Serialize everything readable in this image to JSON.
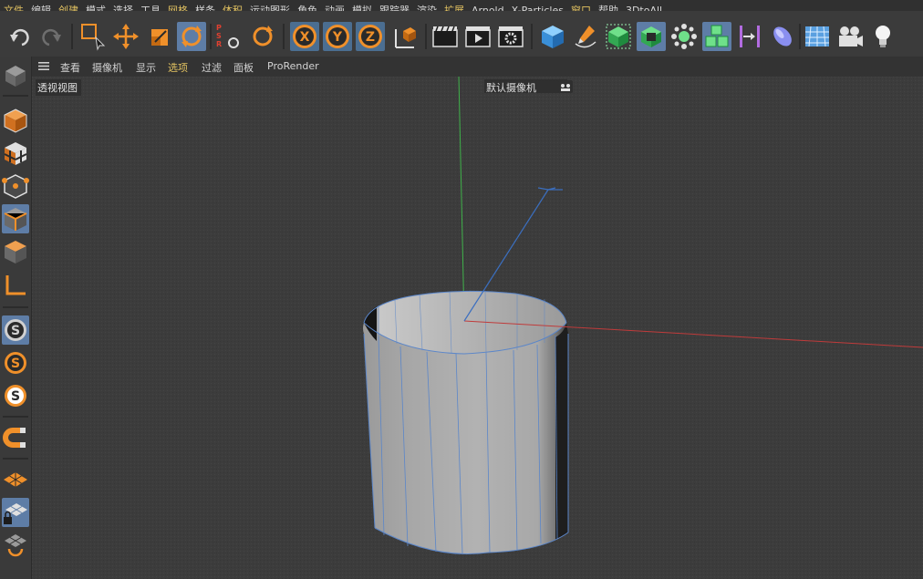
{
  "menubar": {
    "items": [
      {
        "label": "文件",
        "highlight": true
      },
      {
        "label": "编辑",
        "highlight": false
      },
      {
        "label": "创建",
        "highlight": true
      },
      {
        "label": "模式",
        "highlight": false
      },
      {
        "label": "选择",
        "highlight": false
      },
      {
        "label": "工具",
        "highlight": false
      },
      {
        "label": "网格",
        "highlight": true
      },
      {
        "label": "样条",
        "highlight": false
      },
      {
        "label": "体积",
        "highlight": true
      },
      {
        "label": "运动图形",
        "highlight": false
      },
      {
        "label": "角色",
        "highlight": false
      },
      {
        "label": "动画",
        "highlight": false
      },
      {
        "label": "模拟",
        "highlight": false
      },
      {
        "label": "跟踪器",
        "highlight": false
      },
      {
        "label": "渲染",
        "highlight": false
      },
      {
        "label": "扩展",
        "highlight": true
      },
      {
        "label": "Arnold",
        "highlight": false
      },
      {
        "label": "X-Particles",
        "highlight": false
      },
      {
        "label": "窗口",
        "highlight": true
      },
      {
        "label": "帮助",
        "highlight": false
      },
      {
        "label": "3DtoAll",
        "highlight": false
      }
    ]
  },
  "toolbar": {
    "undo_icon": "undo-icon",
    "redo_icon": "redo-icon",
    "select_icon": "rect-select-icon",
    "move_icon": "move-icon",
    "scale_icon": "scale-icon",
    "rotate_icon": "rotate-icon",
    "psr_letters": [
      "P",
      "S",
      "R"
    ],
    "axis_x": "X",
    "axis_y": "Y",
    "axis_z": "Z",
    "colors": {
      "orange": "#f0902a",
      "blue_sel": "#5e7da6",
      "green": "#4fcf6a"
    }
  },
  "viewport_menu": {
    "items": [
      {
        "label": "查看",
        "highlight": false
      },
      {
        "label": "摄像机",
        "highlight": false
      },
      {
        "label": "显示",
        "highlight": false
      },
      {
        "label": "选项",
        "highlight": true
      },
      {
        "label": "过滤",
        "highlight": false
      },
      {
        "label": "面板",
        "highlight": false
      },
      {
        "label": "ProRender",
        "highlight": false
      }
    ]
  },
  "viewport": {
    "title": "透视视图",
    "camera": "默认摄像机",
    "axis_colors": {
      "x": "#c03b3b",
      "y": "#3fb24a",
      "z": "#3b6fc0"
    },
    "object": "cylinder-open-tube"
  }
}
